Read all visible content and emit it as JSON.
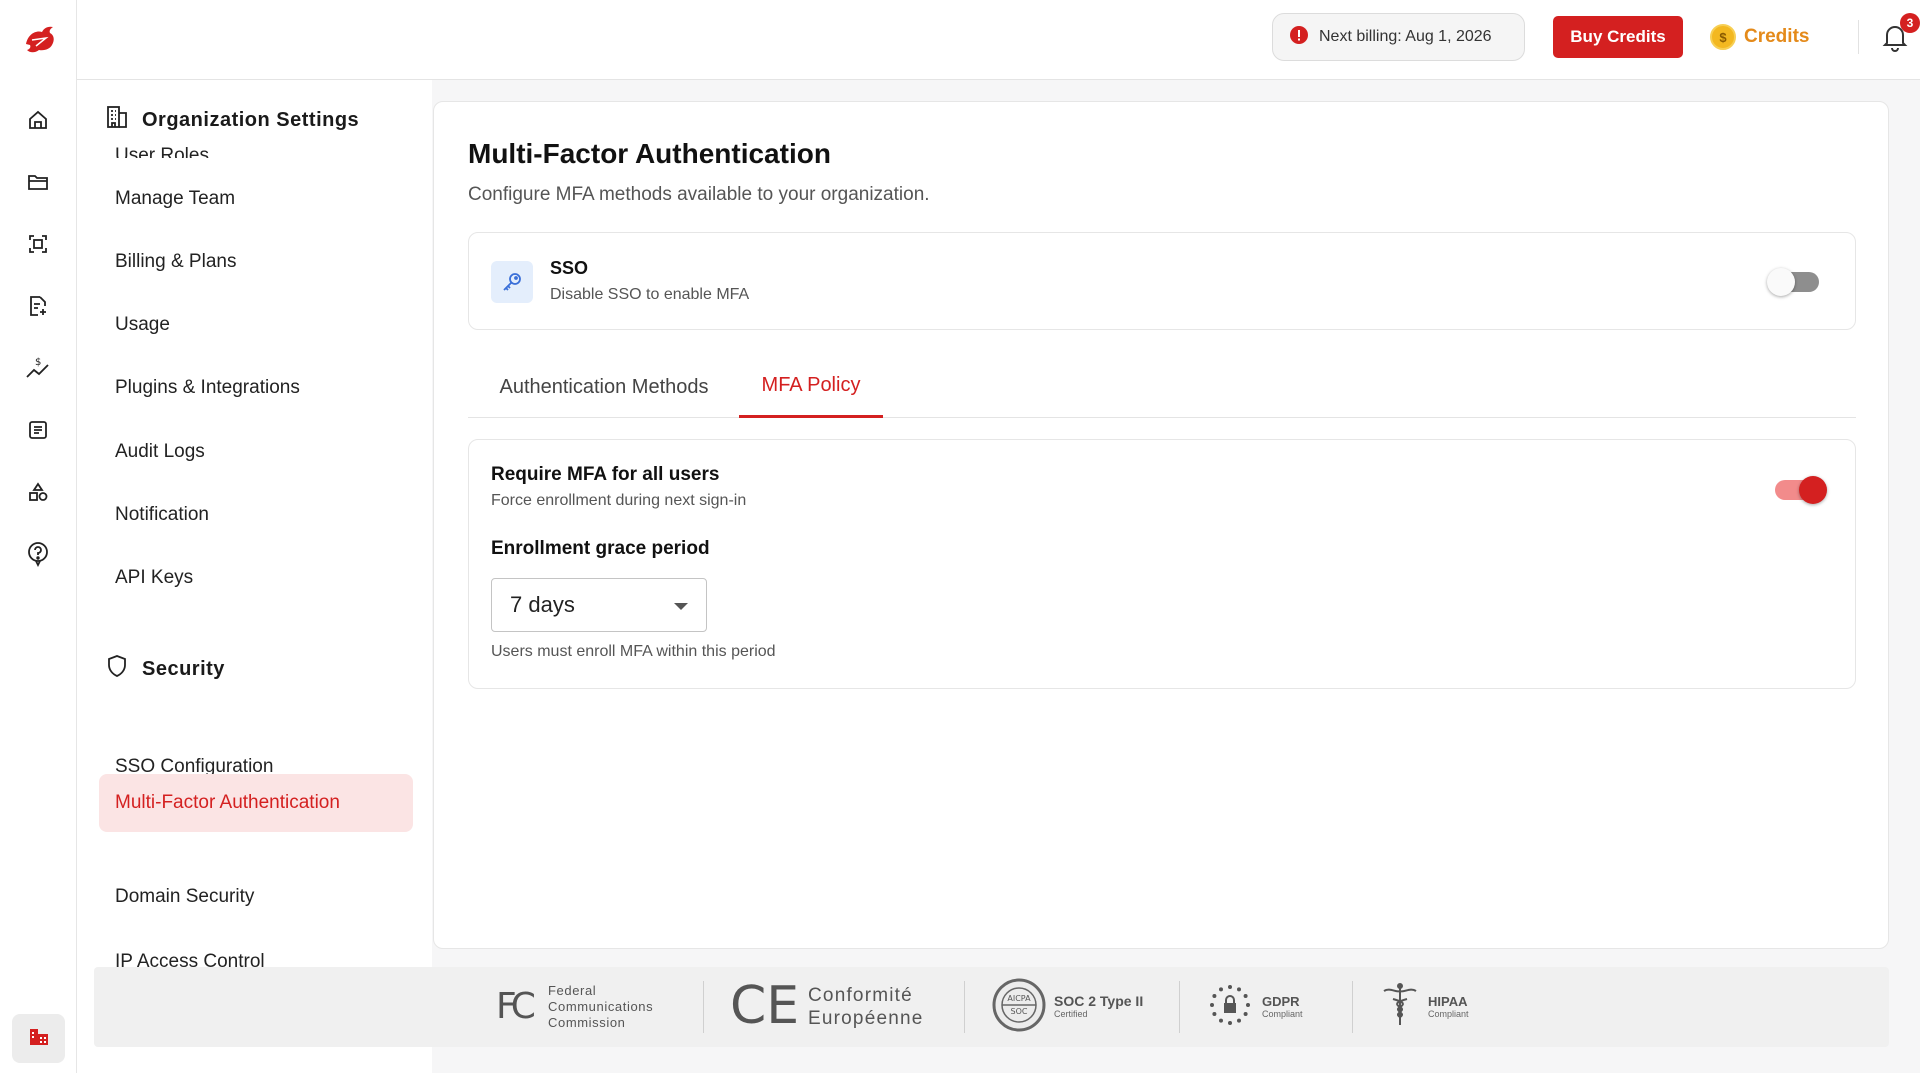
{
  "topbar": {
    "billing_text": "Next billing: Aug 1, 2026",
    "buy_credits_label": "Buy Credits",
    "credits_label": "Credits",
    "notification_count": "3",
    "coin_symbol": "$"
  },
  "rail": {
    "icons": [
      "home-icon",
      "folder-icon",
      "scan-icon",
      "document-add-icon",
      "cost-trend-icon",
      "list-icon",
      "shapes-icon",
      "help-icon"
    ],
    "bottom_icon": "organization-icon"
  },
  "sidebar": {
    "org_section_title": "Organization Settings",
    "org_items": [
      {
        "label": "User Roles"
      },
      {
        "label": "Manage Team"
      },
      {
        "label": "Billing & Plans"
      },
      {
        "label": "Usage"
      },
      {
        "label": "Plugins & Integrations"
      },
      {
        "label": "Audit Logs"
      },
      {
        "label": "Notification"
      },
      {
        "label": "API Keys"
      }
    ],
    "security_section_title": "Security",
    "security_items": [
      {
        "label": "SSO Configuration"
      },
      {
        "label": "Multi-Factor Authentication"
      },
      {
        "label": "Domain Security"
      },
      {
        "label": "IP Access Control"
      }
    ]
  },
  "main": {
    "title": "Multi-Factor Authentication",
    "subtitle": "Configure MFA methods available to your organization.",
    "sso": {
      "title": "SSO",
      "description": "Disable SSO to enable MFA",
      "enabled": false
    },
    "tabs": [
      {
        "label": "Authentication Methods",
        "active": false
      },
      {
        "label": "MFA Policy",
        "active": true
      }
    ],
    "policy": {
      "require_title": "Require MFA for all users",
      "require_desc": "Force enrollment during next sign-in",
      "require_enabled": true,
      "grace_label": "Enrollment grace period",
      "grace_value": "7 days",
      "grace_help": "Users must enroll MFA within this period"
    }
  },
  "compliance": {
    "fcc": {
      "line1": "Federal",
      "line2": "Communications",
      "line3": "Commission",
      "logo": "FC"
    },
    "ce": {
      "line1": "Conformité",
      "line2": "Européenne",
      "logo": "CE"
    },
    "soc": {
      "main": "SOC 2 Type II",
      "sub": "Certified",
      "badge_top": "AICPA",
      "badge_bottom": "SOC"
    },
    "gdpr": {
      "main": "GDPR",
      "sub": "Compliant"
    },
    "hipaa": {
      "main": "HIPAA",
      "sub": "Compliant"
    }
  },
  "colors": {
    "accent": "#d42020",
    "credits": "#e48a1a",
    "active_bg": "#fbe4e4"
  }
}
